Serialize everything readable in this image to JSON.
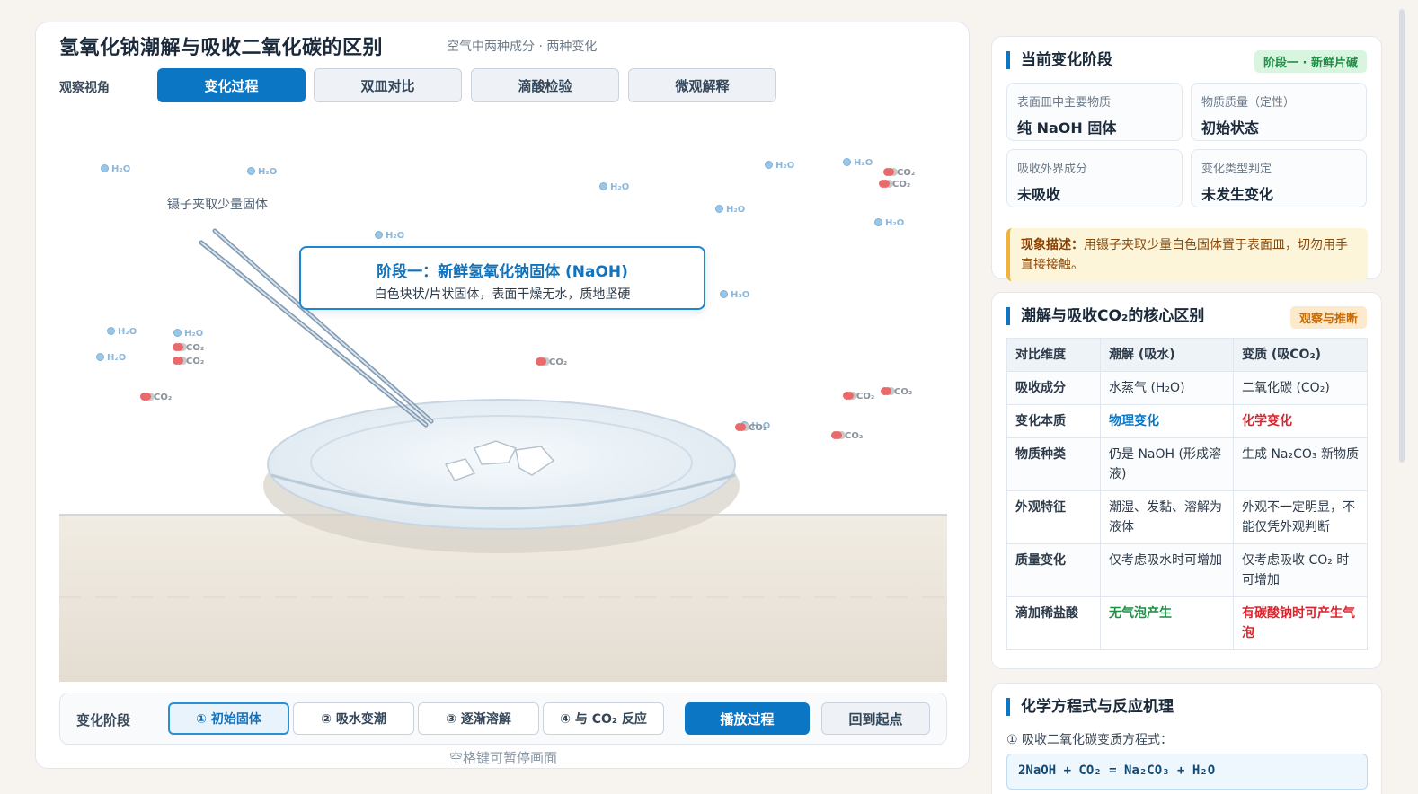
{
  "header": {
    "title": "氢氧化钠潮解与吸收二氧化碳的区别",
    "subtitle": "空气中两种成分 · 两种变化"
  },
  "view": {
    "label": "观察视角",
    "tabs": [
      {
        "label": "变化过程",
        "active": true
      },
      {
        "label": "双皿对比",
        "active": false
      },
      {
        "label": "滴酸检验",
        "active": false
      },
      {
        "label": "微观解释",
        "active": false
      }
    ]
  },
  "scene": {
    "tweezer_label": "镊子夹取少量固体",
    "callout_title": "阶段一：新鲜氢氧化钠固体 (NaOH)",
    "callout_desc": "白色块状/片状固体，表面干燥无水，质地坚硬",
    "molecule_h2o": "H₂O",
    "molecule_co2": "CO₂"
  },
  "stage_bar": {
    "label": "变化阶段",
    "stages": [
      {
        "label": "① 初始固体",
        "active": true
      },
      {
        "label": "② 吸水变潮",
        "active": false
      },
      {
        "label": "③ 逐渐溶解",
        "active": false
      },
      {
        "label": "④ 与 CO₂ 反应",
        "active": false
      }
    ],
    "play": "播放过程",
    "reset": "回到起点",
    "hint": "空格键可暂停画面"
  },
  "current_stage": {
    "title": "当前变化阶段",
    "badge": "阶段一 · 新鲜片碱",
    "boxes": [
      {
        "label": "表面皿中主要物质",
        "value": "纯 NaOH 固体"
      },
      {
        "label": "物质质量（定性）",
        "value": "初始状态"
      },
      {
        "label": "吸收外界成分",
        "value": "未吸收"
      },
      {
        "label": "变化类型判定",
        "value": "未发生变化"
      }
    ],
    "phenomenon_label": "现象描述：",
    "phenomenon_text": "用镊子夹取少量白色固体置于表面皿，切勿用手直接接触。"
  },
  "comparison": {
    "title": "潮解与吸收CO₂的核心区别",
    "badge": "观察与推断",
    "headers": [
      "对比维度",
      "潮解 (吸水)",
      "变质 (吸CO₂)"
    ],
    "rows": [
      {
        "dim": "吸收成分",
        "a": "水蒸气 (H₂O)",
        "b": "二氧化碳 (CO₂)",
        "style": ""
      },
      {
        "dim": "变化本质",
        "a": "物理变化",
        "b": "化学变化",
        "style": "nature"
      },
      {
        "dim": "物质种类",
        "a": "仍是 NaOH (形成溶液)",
        "b": "生成 Na₂CO₃ 新物质",
        "style": ""
      },
      {
        "dim": "外观特征",
        "a": "潮湿、发黏、溶解为液体",
        "b": "外观不一定明显，不能仅凭外观判断",
        "style": ""
      },
      {
        "dim": "质量变化",
        "a": "仅考虑吸水时可增加",
        "b": "仅考虑吸收 CO₂ 时可增加",
        "style": ""
      },
      {
        "dim": "滴加稀盐酸",
        "a": "无气泡产生",
        "b": "有碳酸钠时可产生气泡",
        "style": "acid"
      }
    ]
  },
  "equation": {
    "title": "化学方程式与反应机理",
    "label": "① 吸收二氧化碳变质方程式：",
    "formula": "2NaOH + CO₂ = Na₂CO₃ + H₂O"
  },
  "colors": {
    "accent": "#0b76c4",
    "physical": "#0b76c4",
    "chemical": "#d8252e",
    "no_bubble": "#1d8f46",
    "stage_badge": "#1d8f46",
    "compare_badge": "#c96c05"
  }
}
